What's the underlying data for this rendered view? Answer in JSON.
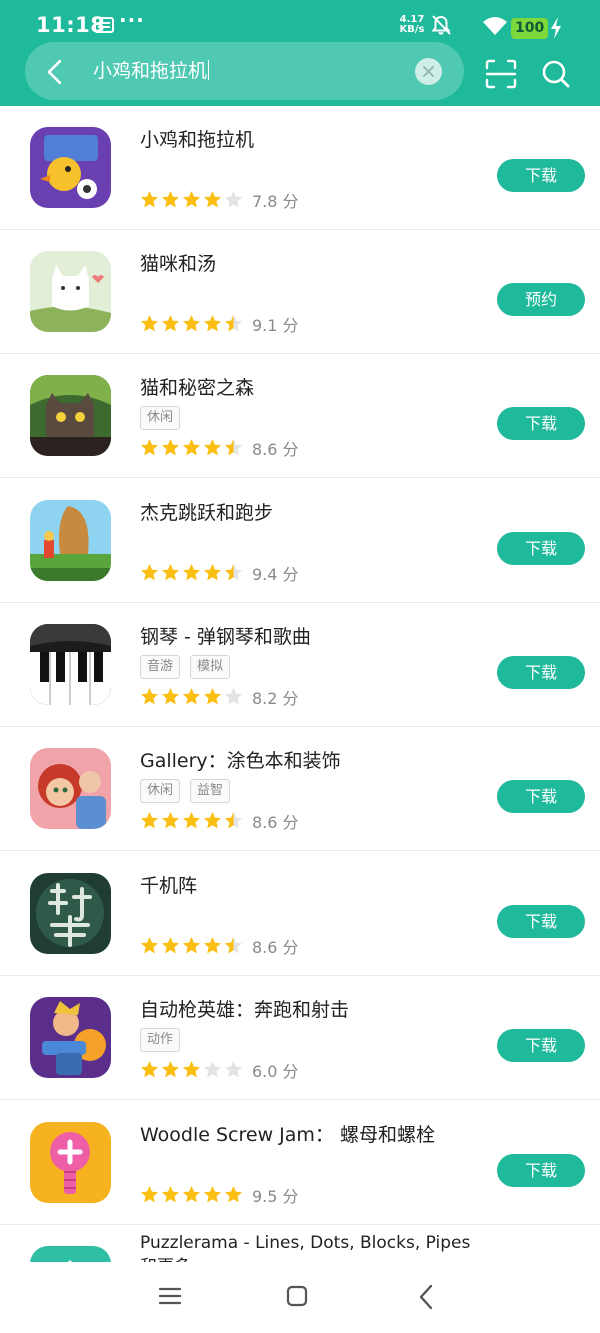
{
  "status_bar": {
    "time": "11:18",
    "dots": "···",
    "speed_value": "4.17",
    "speed_unit": "KB/s",
    "battery": "100",
    "icons": [
      "notification-icon",
      "mute-bell-icon",
      "wifi-icon",
      "battery-icon",
      "charging-icon"
    ]
  },
  "search": {
    "query": "小鸡和拖拉机",
    "back_icon": "chevron-left-icon",
    "clear_icon": "close-icon",
    "scan_icon": "scan-icon",
    "search_icon": "search-icon"
  },
  "colors": {
    "accent": "#1fb99b",
    "star": "#fbbf14",
    "star_empty": "#e3e3e3"
  },
  "apps": [
    {
      "name": "小鸡和拖拉机",
      "tags": [],
      "rating": 4.0,
      "score": "7.8 分",
      "action": "下载"
    },
    {
      "name": "猫咪和汤",
      "tags": [],
      "rating": 4.5,
      "score": "9.1 分",
      "action": "预约"
    },
    {
      "name": "猫和秘密之森",
      "tags": [
        "休闲"
      ],
      "rating": 4.5,
      "score": "8.6 分",
      "action": "下载"
    },
    {
      "name": "杰克跳跃和跑步",
      "tags": [],
      "rating": 4.5,
      "score": "9.4 分",
      "action": "下载"
    },
    {
      "name": "钢琴 - 弹钢琴和歌曲",
      "tags": [
        "音游",
        "模拟"
      ],
      "rating": 4.0,
      "score": "8.2 分",
      "action": "下载"
    },
    {
      "name": "Gallery：涂色本和装饰",
      "tags": [
        "休闲",
        "益智"
      ],
      "rating": 4.5,
      "score": "8.6 分",
      "action": "下载"
    },
    {
      "name": "千机阵",
      "tags": [],
      "rating": 4.5,
      "score": "8.6 分",
      "action": "下载"
    },
    {
      "name": "自动枪英雄：奔跑和射击",
      "tags": [
        "动作"
      ],
      "rating": 3.0,
      "score": "6.0 分",
      "action": "下载"
    },
    {
      "name": "Woodle Screw Jam： 螺母和螺栓",
      "tags": [],
      "rating": 5.0,
      "score": "9.5 分",
      "action": "下载"
    },
    {
      "name": "Puzzlerama - Lines, Dots, Blocks, Pipes和更多",
      "tags": [],
      "rating": null,
      "score": "",
      "action": ""
    }
  ],
  "navbar": {
    "icons": [
      "menu-icon",
      "home-icon",
      "back-icon"
    ]
  }
}
